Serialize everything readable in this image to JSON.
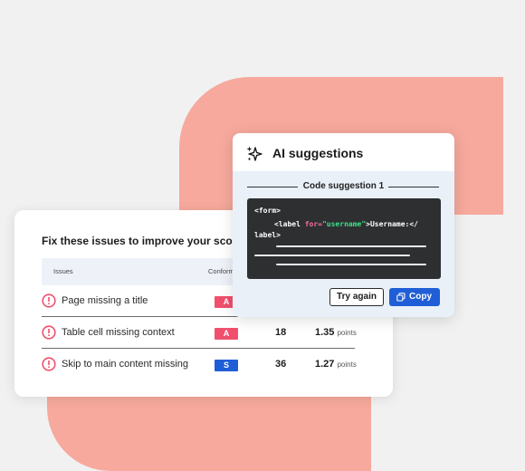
{
  "issues_card": {
    "title": "Fix these issues to improve your score",
    "columns": {
      "issues": "Issues",
      "conformance": "Conform"
    },
    "rows": [
      {
        "label": "Page missing a title",
        "level": "A",
        "level_color": "#f0506e",
        "count": "",
        "points": "",
        "points_unit": ""
      },
      {
        "label": "Table cell missing context",
        "level": "A",
        "level_color": "#f0506e",
        "count": "18",
        "points": "1.35",
        "points_unit": "points"
      },
      {
        "label": "Skip to main content missing",
        "level": "S",
        "level_color": "#1f5ed6",
        "count": "36",
        "points": "1.27",
        "points_unit": "points"
      }
    ]
  },
  "ai_card": {
    "title": "AI suggestions",
    "section_label": "Code suggestion 1",
    "code": {
      "line1": "<form>",
      "line2_open": "<label ",
      "line2_attr": "for=",
      "line2_value": "\"username\"",
      "line2_text": ">Username:</",
      "line3": "label>"
    },
    "try_again_label": "Try again",
    "copy_label": "Copy"
  },
  "colors": {
    "accent_blue": "#1f5ed6",
    "alert_red": "#f0506e",
    "blob": "#f6a99c"
  }
}
